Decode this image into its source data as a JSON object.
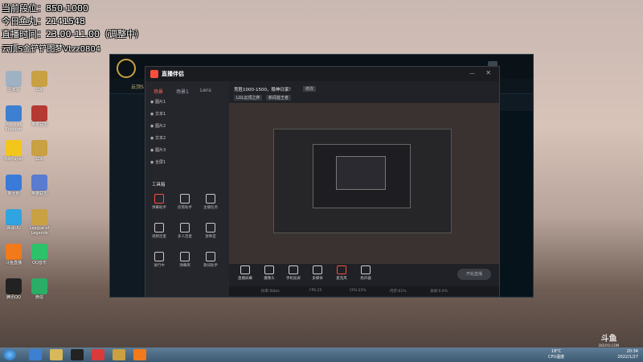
{
  "overlay": {
    "rank_line": "当前段位：850-1000",
    "earnings_line": "今日鱼丸：2141548",
    "hours_line": "直播时间：23.00-11.00（调整中）",
    "extra_line": "云顶S金铲铲图梦Vtzz0804"
  },
  "desktop_icons": [
    {
      "label": "回收站",
      "color": "#9fb2c4"
    },
    {
      "label": "LOL",
      "color": "#c9a042"
    },
    {
      "label": "Internet Explorer",
      "color": "#3d7fd1"
    },
    {
      "label": "英雄联盟",
      "color": "#b43a33"
    },
    {
      "label": "PotPlayer",
      "color": "#f3c61c"
    },
    {
      "label": "LOL",
      "color": "#c9a042"
    },
    {
      "label": "鲁大师",
      "color": "#3a7ad9"
    },
    {
      "label": "英雄联盟",
      "color": "#5a7bd0"
    },
    {
      "label": "网易UU",
      "color": "#2fa4e0"
    },
    {
      "label": "League of Legends",
      "color": "#c9a042"
    },
    {
      "label": "斗鱼直播",
      "color": "#f27a1a"
    },
    {
      "label": "QQ音乐",
      "color": "#2cc26a"
    },
    {
      "label": "腾讯QQ",
      "color": "#222222"
    },
    {
      "label": "微信",
      "color": "#2aae67"
    }
  ],
  "game_window": {
    "name": "云顶S"
  },
  "app": {
    "logo_text": "直播伴侣",
    "title": "竞胜1000-1500，稳神日家！",
    "title_tag": "修改",
    "tags": [
      "LOL云顶之弈",
      "新闻首王者"
    ],
    "tabs": [
      "场景",
      "场景1",
      "Lens"
    ],
    "layers": [
      "图片1",
      "文本1",
      "图片2",
      "文本2",
      "图片3",
      "全屏1"
    ],
    "tools_heading": "工具箱",
    "tools": [
      "弹幕助手",
      "房管助手",
      "主播任务",
      "视频连麦",
      "多人连麦",
      "放映室",
      "进行中",
      "弹幕库",
      "歌词助手"
    ],
    "bottom_tools": [
      "直播屏幕",
      "摄像头",
      "手机投屏",
      "多媒体",
      "麦克风",
      "扬声器"
    ],
    "start_button": "开始直播",
    "status": [
      "码率:0kb/s",
      "FPS:25",
      "CPU:25%",
      "内存:61%",
      "丢帧:0.0%"
    ]
  },
  "taskbar": {
    "temp": "18°C",
    "weather": "CPU温度",
    "time": "20:34",
    "date": "2022/1/27"
  },
  "watermark": {
    "brand": "斗鱼",
    "site": "DOUYU.COM"
  },
  "colors": {
    "accent": "#ff4d3d",
    "brand": "#f27a1a"
  }
}
